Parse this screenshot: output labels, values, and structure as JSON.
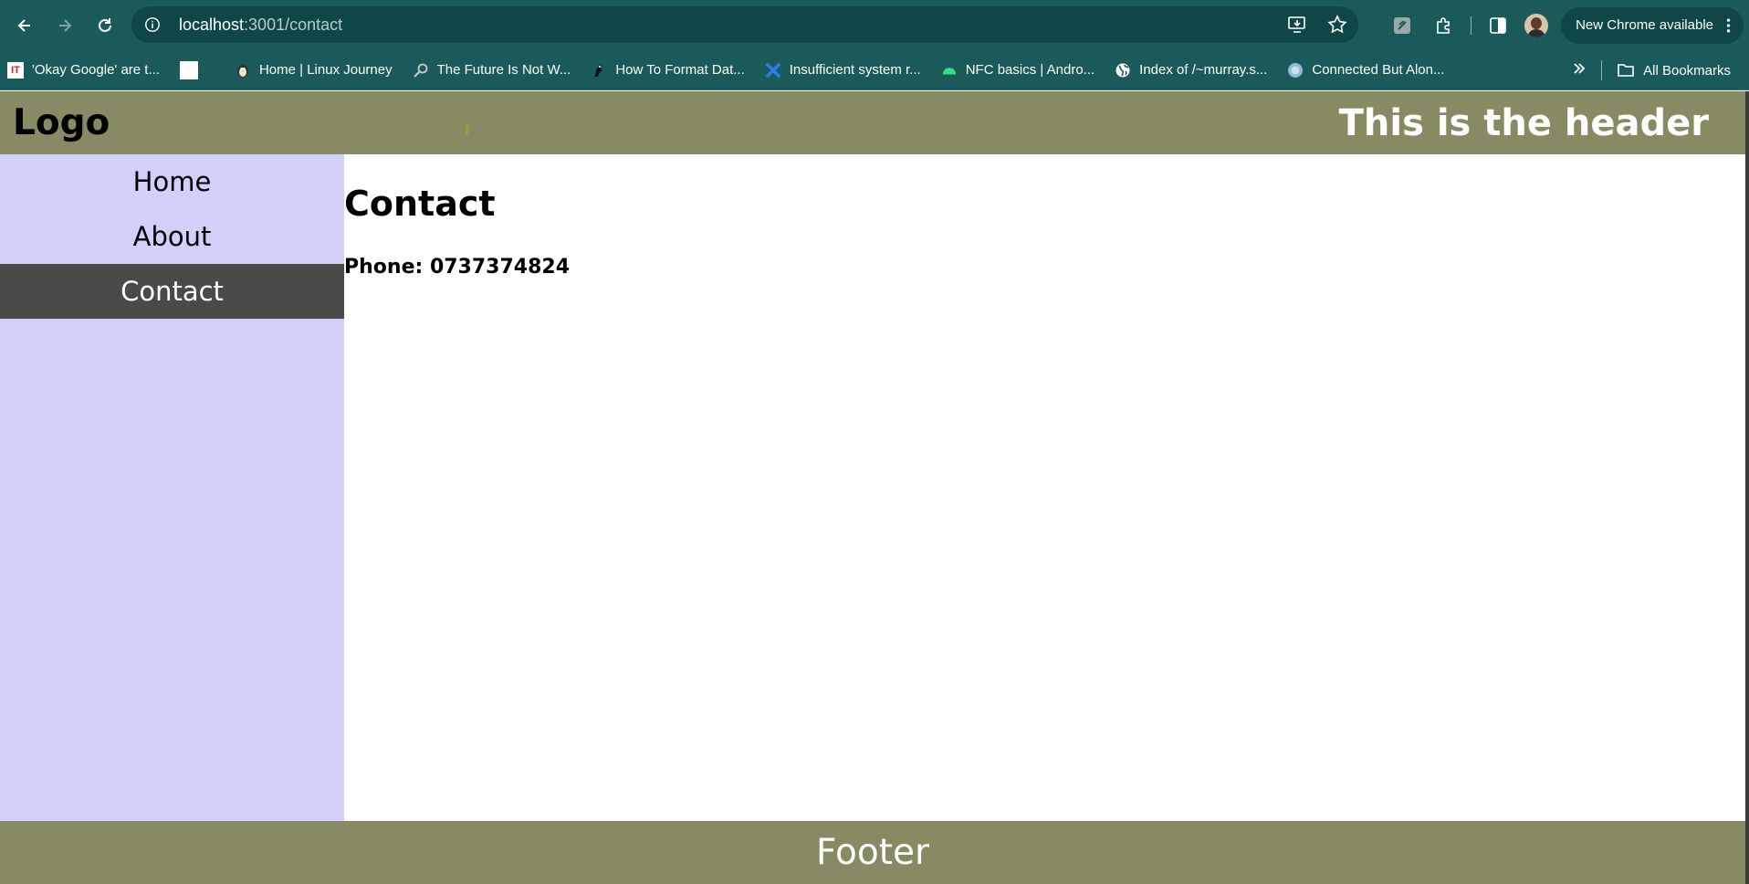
{
  "browser": {
    "url_host": "localhost",
    "url_path": ":3001/contact",
    "update_label": "New Chrome available",
    "bookmarks": [
      {
        "label": "'Okay Google' are t...",
        "icon": "it-favicon"
      },
      {
        "label": "",
        "icon": "blank-favicon"
      },
      {
        "label": "Home | Linux Journey",
        "icon": "penguin-favicon"
      },
      {
        "label": "The Future Is Not W...",
        "icon": "magnifier-favicon"
      },
      {
        "label": "How To Format Dat...",
        "icon": "bird-favicon"
      },
      {
        "label": "Insufficient system r...",
        "icon": "vscode-favicon"
      },
      {
        "label": "NFC basics  |  Andro...",
        "icon": "android-favicon"
      },
      {
        "label": "Index of /~murray.s...",
        "icon": "globe-favicon"
      },
      {
        "label": "Connected But Alon...",
        "icon": "ted-favicon"
      }
    ],
    "all_bookmarks_label": "All Bookmarks"
  },
  "header": {
    "logo": "Logo",
    "title": "This is the header"
  },
  "sidebar": {
    "items": [
      {
        "label": "Home",
        "active": false
      },
      {
        "label": "About",
        "active": false
      },
      {
        "label": "Contact",
        "active": true
      }
    ]
  },
  "main": {
    "heading": "Contact",
    "phone": "Phone: 0737374824"
  },
  "footer": {
    "text": "Footer"
  },
  "colors": {
    "chrome": "#1b5a5a",
    "header_footer": "#878a63",
    "sidebar": "#d2d0f8",
    "active_item": "#4a4a4a"
  }
}
